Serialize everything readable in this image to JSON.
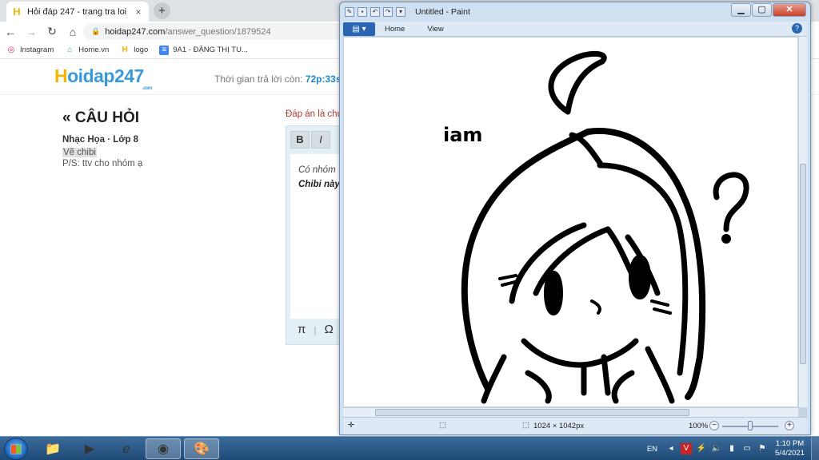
{
  "browser": {
    "tab_title": "Hỏi đáp 247 - trang tra loi",
    "tab_close": "×",
    "new_tab": "+",
    "url_host": "hoidap247.com",
    "url_path": "/answer_question/1879524",
    "bookmarks": [
      {
        "label": "Instagram",
        "icon": "instagram-icon"
      },
      {
        "label": "Home.vn",
        "icon": "home-icon"
      },
      {
        "label": "logo",
        "icon": "hoidap-logo-icon"
      },
      {
        "label": "9A1 - ĐẶNG THỊ TU...",
        "icon": "docs-icon"
      }
    ]
  },
  "site": {
    "logo_main": "oidap247",
    "logo_h": "H",
    "logo_com": ".com",
    "timer_label": "Thời gian trả lời còn:",
    "timer_value": "72p:33s",
    "question_heading": "« CÂU HỎI",
    "question_meta": "Nhạc Họa · Lớp 8",
    "question_body": "Vẽ chibi",
    "question_ps": "P/S: ttv cho nhóm ạ",
    "answer_label": "Đáp án là chu",
    "editor_bold": "B",
    "editor_italic": "I",
    "editor_line1": "Có nhóm",
    "editor_line2": "Chibi này",
    "editor_pi": "π",
    "editor_omega": "Ω"
  },
  "paint": {
    "title": "Untitled - Paint",
    "menu_button": "▤ ▾",
    "tabs": [
      "Home",
      "View"
    ],
    "help": "?",
    "dimensions": "1024 × 1042px",
    "zoom": "100%",
    "zoom_minus": "−",
    "zoom_plus": "+",
    "drawing_text": "iam"
  },
  "taskbar": {
    "lang": "EN",
    "time": "1:10 PM",
    "date": "5/4/2021"
  }
}
